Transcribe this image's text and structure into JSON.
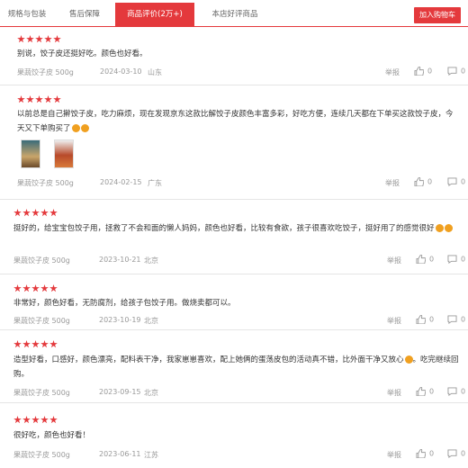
{
  "tabs": [
    "规格与包装",
    "售后保障",
    "商品评价(2万+)",
    "本店好评商品"
  ],
  "cart_button": "加入购物车",
  "report_label": "举报",
  "reviews": [
    {
      "stars": 5,
      "text": "别说，饺子皮还挺好吃。颜色也好看。",
      "product": "果蔬饺子皮 500g",
      "date": "2024-03-10",
      "region": "山东",
      "likes": "0",
      "comments": "0"
    },
    {
      "stars": 5,
      "text": "以前总是自己擀饺子皮，吃力麻烦，现在发现京东这款比解饺子皮颜色丰富多彩，好吃方便，连续几天都在下单买这款饺子皮，今天又下单购买了",
      "product": "果蔬饺子皮 500g",
      "date": "2024-02-15",
      "region": "广东",
      "likes": "0",
      "comments": "0"
    },
    {
      "stars": 5,
      "text": "挺好的，给宝宝包饺子用，拯救了不会和面的懒人妈妈，颜色也好看，比较有食欲，孩子很喜欢吃饺子，挺好用了的感觉很好",
      "product": "果蔬饺子皮 500g",
      "date": "2023-10-21",
      "region": "北京",
      "likes": "0",
      "comments": "0"
    },
    {
      "stars": 5,
      "text": "非常好，颜色好看，无防腐剂，给孩子包饺子用。做烧卖都可以。",
      "product": "果蔬饺子皮 500g",
      "date": "2023-10-19",
      "region": "北京",
      "likes": "0",
      "comments": "0"
    },
    {
      "stars": 5,
      "text": "造型好看，口感好，颜色漂亮，配料表干净，我家崽崽喜欢，配上她俩的蛋荡皮包的活动真不错，比外面干净又放心",
      "text2": "。吃完继续回购。",
      "product": "果蔬饺子皮 500g",
      "date": "2023-09-15",
      "region": "北京",
      "likes": "0",
      "comments": "0"
    },
    {
      "stars": 5,
      "text": "很好吃，颜色也好看！",
      "product": "果蔬饺子皮 500g",
      "date": "2023-06-11",
      "region": "江苏",
      "likes": "0",
      "comments": "0"
    }
  ],
  "colors": {
    "accent": "#e4393c",
    "muted": "#999999"
  }
}
